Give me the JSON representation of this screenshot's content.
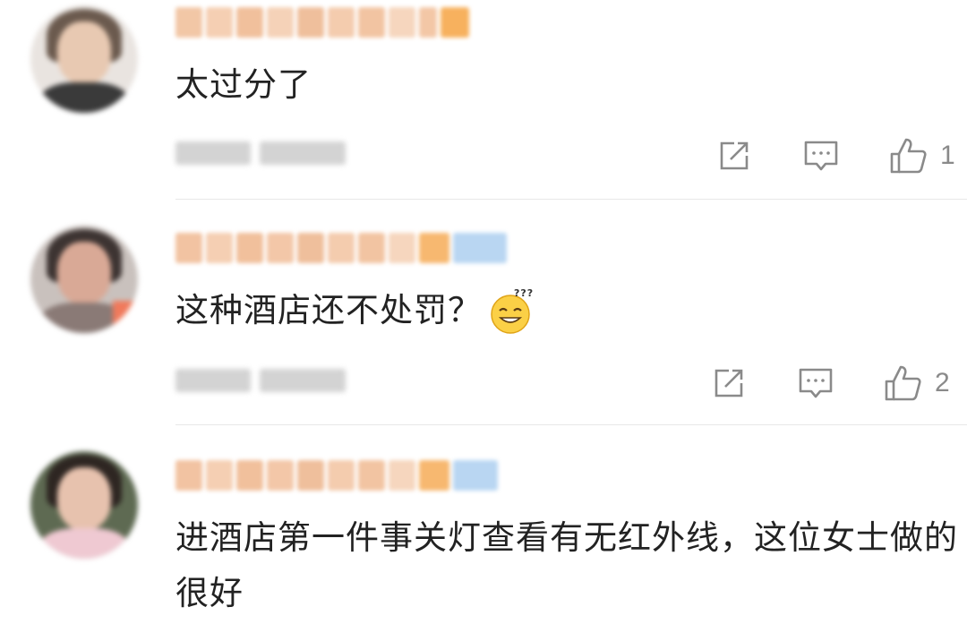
{
  "comments": [
    {
      "text": "太过分了",
      "likes": "1",
      "actions": {
        "share": "share-icon",
        "reply": "comment-icon",
        "like": "thumbs-up-icon"
      }
    },
    {
      "text": "这种酒店还不处罚？",
      "emoji": "confused-smile-emoji",
      "likes": "2",
      "actions": {
        "share": "share-icon",
        "reply": "comment-icon",
        "like": "thumbs-up-icon"
      }
    },
    {
      "text": "进酒店第一件事关灯查看有无红外线，这位女士做的很好",
      "actions": {}
    }
  ],
  "colors": {
    "text": "#222222",
    "meta": "#8a8a8a",
    "divider": "#e8e8e8",
    "username_blur": "#f5c9a8"
  }
}
